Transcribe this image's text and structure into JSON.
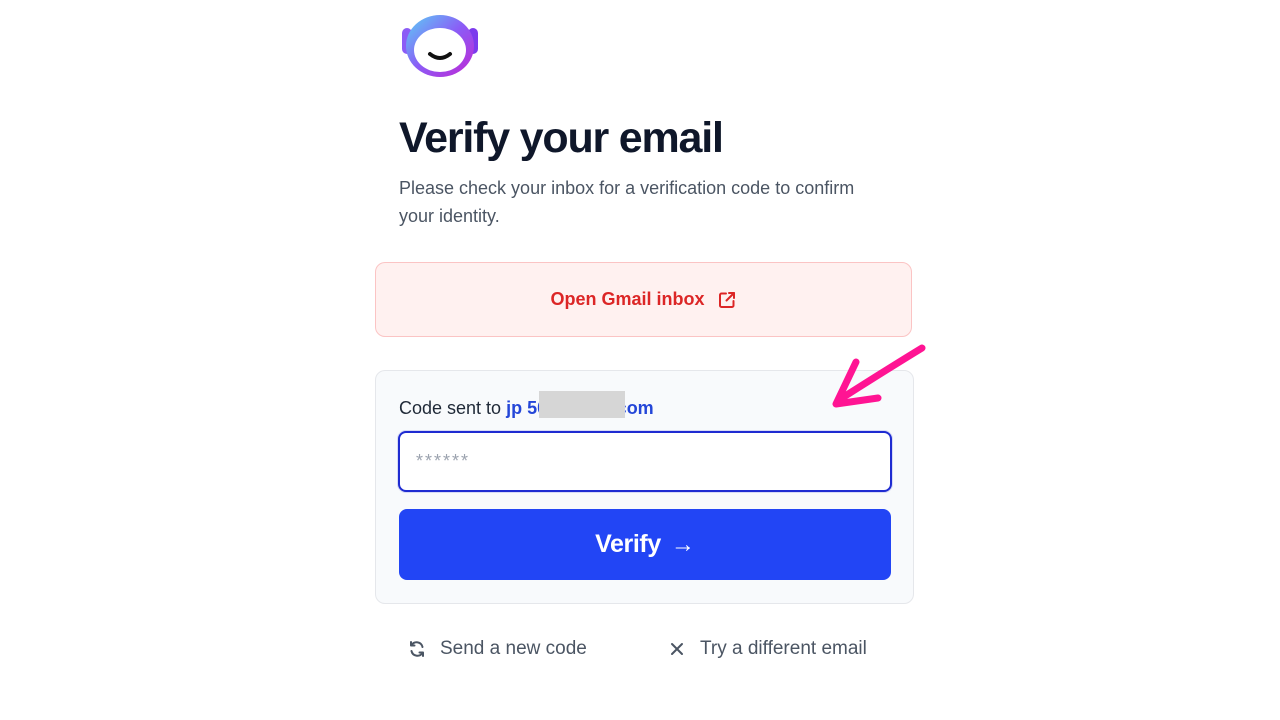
{
  "logo": {
    "icon": "smiling-face-logo-icon",
    "gradient": [
      "#5ad1f5",
      "#8b5cf6",
      "#c026d3"
    ]
  },
  "title": "Verify your email",
  "subtitle": "Please check your inbox for a verification code to confirm your identity.",
  "gmail_button": {
    "label": "Open Gmail inbox",
    "icon": "external-link-icon",
    "color": "#dc2626"
  },
  "code_card": {
    "sent_prefix": "Code sent to",
    "email": "jp      50@gmail.com",
    "input_placeholder": "******",
    "input_value": ""
  },
  "verify_button": {
    "label": "Verify",
    "icon": "arrow-right-icon",
    "color": "#2245f5"
  },
  "links": {
    "resend": {
      "label": "Send a new code",
      "icon": "refresh-icon"
    },
    "different_email": {
      "label": "Try a different email",
      "icon": "close-icon"
    }
  },
  "annotation": {
    "icon": "pink-pointer-arrow-icon",
    "color": "#ff1493"
  }
}
